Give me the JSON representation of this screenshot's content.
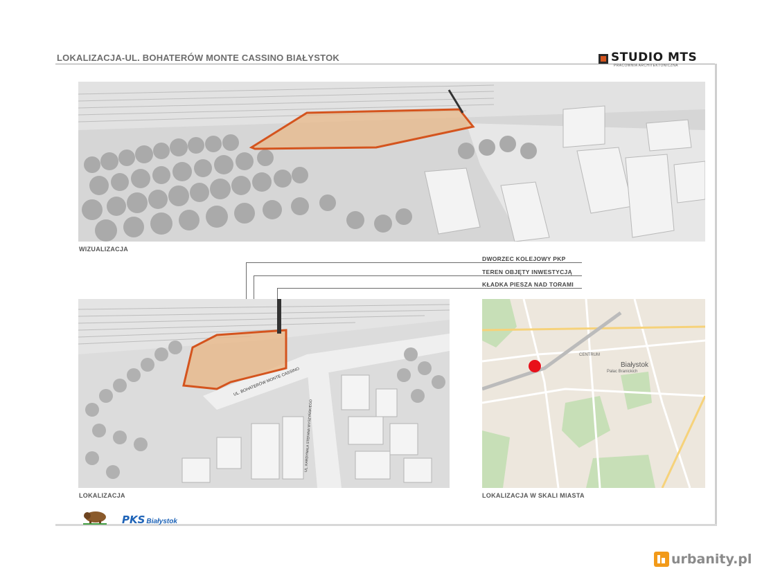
{
  "header": {
    "title": "LOKALIZACJA-UL. BOHATERÓW MONTE CASSINO BIAŁYSTOK",
    "logo_text": "STUDIO MTS",
    "logo_subtitle": "PRACOWNIA ARCHITEKTONICZNA"
  },
  "panels": {
    "visualization_caption": "WIZUALIZACJA",
    "location_caption": "LOKALIZACJA",
    "city_map_caption": "LOKALIZACJA W SKALI MIASTA"
  },
  "callouts": [
    {
      "label": "DWORZEC KOLEJOWY PKP"
    },
    {
      "label": "TEREN OBJĘTY INWESTYCJĄ"
    },
    {
      "label": "KŁADKA PIESZA NAD TORAMI"
    }
  ],
  "map_labels": {
    "street_monte_cassino": "UL. BOHATERÓW MONTE CASSINO",
    "street_other": "UL. KARDYNAŁA STEFANA WYSZYŃSKIEGO",
    "city": "Białystok",
    "district_1": "CENTRUM",
    "district_2": "Pałac Branickich"
  },
  "sponsors": {
    "pks_mark": "PKS",
    "pks_city": "Białystok"
  },
  "watermark": {
    "text": "urbanity.pl"
  },
  "colors": {
    "highlight_fill": "#e8b888",
    "highlight_stroke": "#d4541e",
    "map_marker": "#e8101a",
    "logo_accent": "#d4541e"
  }
}
